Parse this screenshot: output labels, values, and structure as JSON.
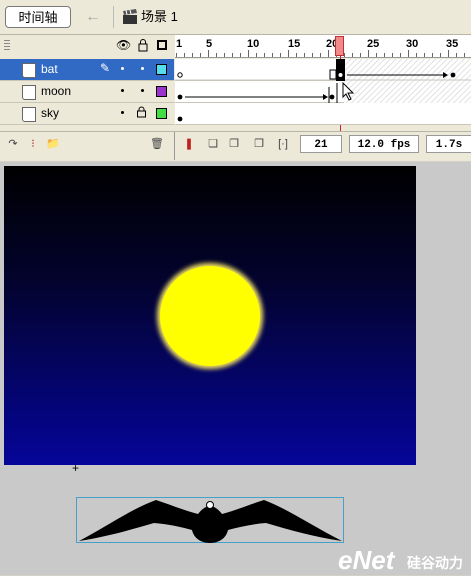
{
  "toolbar": {
    "timeline_label": "时间轴",
    "back_icon": "arrow-left-icon",
    "scene_icon": "clapperboard-icon",
    "scene_label": "场景 1"
  },
  "timeline": {
    "header_icons": [
      "eye-icon",
      "lock-icon",
      "outline-square-icon"
    ],
    "frame_numbers": [
      "1",
      "5",
      "10",
      "15",
      "20",
      "25",
      "30",
      "35"
    ],
    "current_frame": "21",
    "frame_rate": "12.0 fps",
    "elapsed_time": "1.7s",
    "layers": [
      {
        "name": "bat",
        "selected": true,
        "color": "#55ddee",
        "locked": false
      },
      {
        "name": "moon",
        "selected": false,
        "color": "#9933cc",
        "locked": false
      },
      {
        "name": "sky",
        "selected": false,
        "color": "#44dd44",
        "locked": true
      }
    ],
    "bottom_icons": [
      "insert-layer-icon",
      "add-motion-guide-icon",
      "insert-folder-icon",
      "delete-layer-icon",
      "center-frame-icon",
      "onion-skin-icon",
      "onion-skin-outlines-icon",
      "edit-multiple-frames-icon",
      "modify-onion-markers-icon"
    ]
  },
  "stage": {
    "sky_colors": [
      "#000000",
      "#05059a"
    ],
    "moon_color": "#ffff00",
    "crosshair": "+"
  },
  "watermark": {
    "brand": "eNet",
    "sub": "硅谷动力"
  }
}
